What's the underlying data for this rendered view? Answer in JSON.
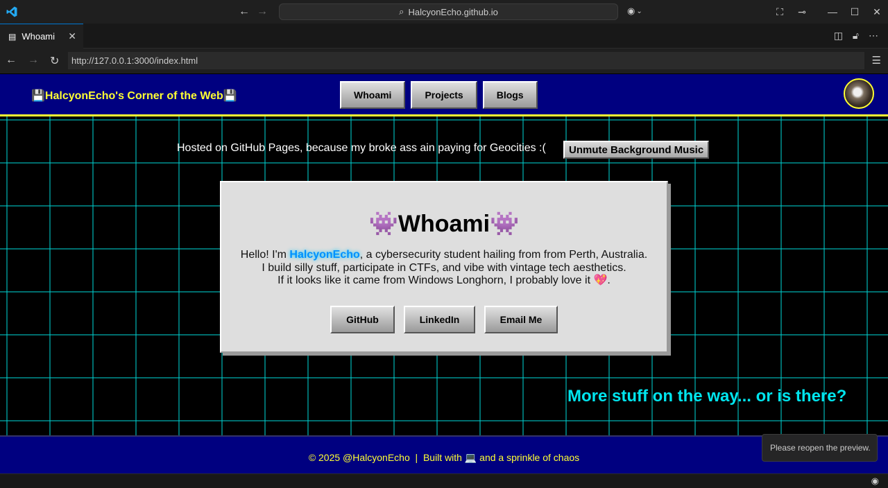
{
  "titlebar": {
    "command_center": "HalcyonEcho.github.io",
    "copilot": "⌘"
  },
  "tab": {
    "label": "Whoami"
  },
  "address": {
    "url": "http://127.0.0.1:3000/index.html"
  },
  "site": {
    "title": "💾HalcyonEcho's Corner of the Web💾",
    "nav": [
      "Whoami",
      "Projects",
      "Blogs"
    ],
    "hosted": "Hosted on GitHub Pages, because my broke ass ain paying for Geocities :(",
    "unmute": "Unmute Background Music",
    "card": {
      "title": "👾Whoami👾",
      "greeting": "Hello! I'm ",
      "handle": "HalcyonEcho",
      "line1_rest": ", a cybersecurity student hailing from from Perth, Australia.",
      "line2": "I build silly stuff, participate in CTFs, and vibe with vintage tech aesthetics.",
      "line3": "If it looks like it came from Windows Longhorn, I probably love it 💖.",
      "links": [
        "GitHub",
        "LinkedIn",
        "Email Me"
      ]
    },
    "more": "More stuff on the way... or is there?",
    "footer": "© 2025 @HalcyonEcho  |  Built with 💻 and a sprinkle of chaos"
  },
  "toast": "Please reopen the preview.",
  "colors": {
    "header_bg": "#000080",
    "accent_yellow": "#ffff33",
    "grid": "#00c8c8",
    "cyan_text": "#00e5ee"
  }
}
